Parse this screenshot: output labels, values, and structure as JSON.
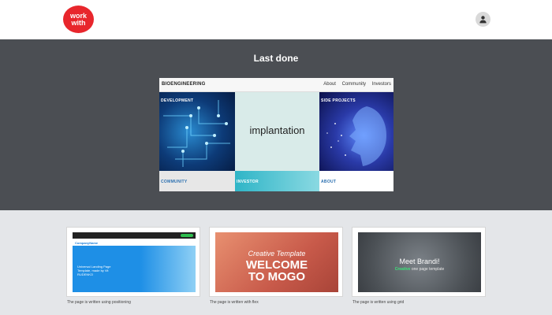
{
  "header": {
    "logo_line1": "work",
    "logo_line2": "with",
    "user_icon": "user-icon"
  },
  "hero": {
    "title": "Last done",
    "featured": {
      "brand": "BIOENGINEERING",
      "links": [
        "About",
        "Community",
        "Investors"
      ],
      "tiles": {
        "development": "DEVELOPMENT",
        "implantation": "implantation",
        "side_projects": "SIDE PROJECTS",
        "community": "COMMUNITY",
        "investor": "INVESTOR",
        "about": "ABOUT"
      }
    }
  },
  "gallery": {
    "cards": [
      {
        "caption": "The page is written using positioning",
        "preview_logo": "CompanyName",
        "preview_text": "Universal Landing Page Template, made by Vit RUDENKO"
      },
      {
        "caption": "The page is written with flex",
        "preview_script": "Creative Template",
        "preview_heading_1": "WELCOME",
        "preview_heading_2": "TO MOGO"
      },
      {
        "caption": "The page is written using grid",
        "preview_heading": "Meet Brandi!",
        "preview_sub_accent": "Creative",
        "preview_sub_rest": " one page template"
      }
    ]
  },
  "colors": {
    "logo": "#e8262c",
    "hero_bg": "#4b4e53",
    "gallery_bg": "#e4e6e9"
  }
}
